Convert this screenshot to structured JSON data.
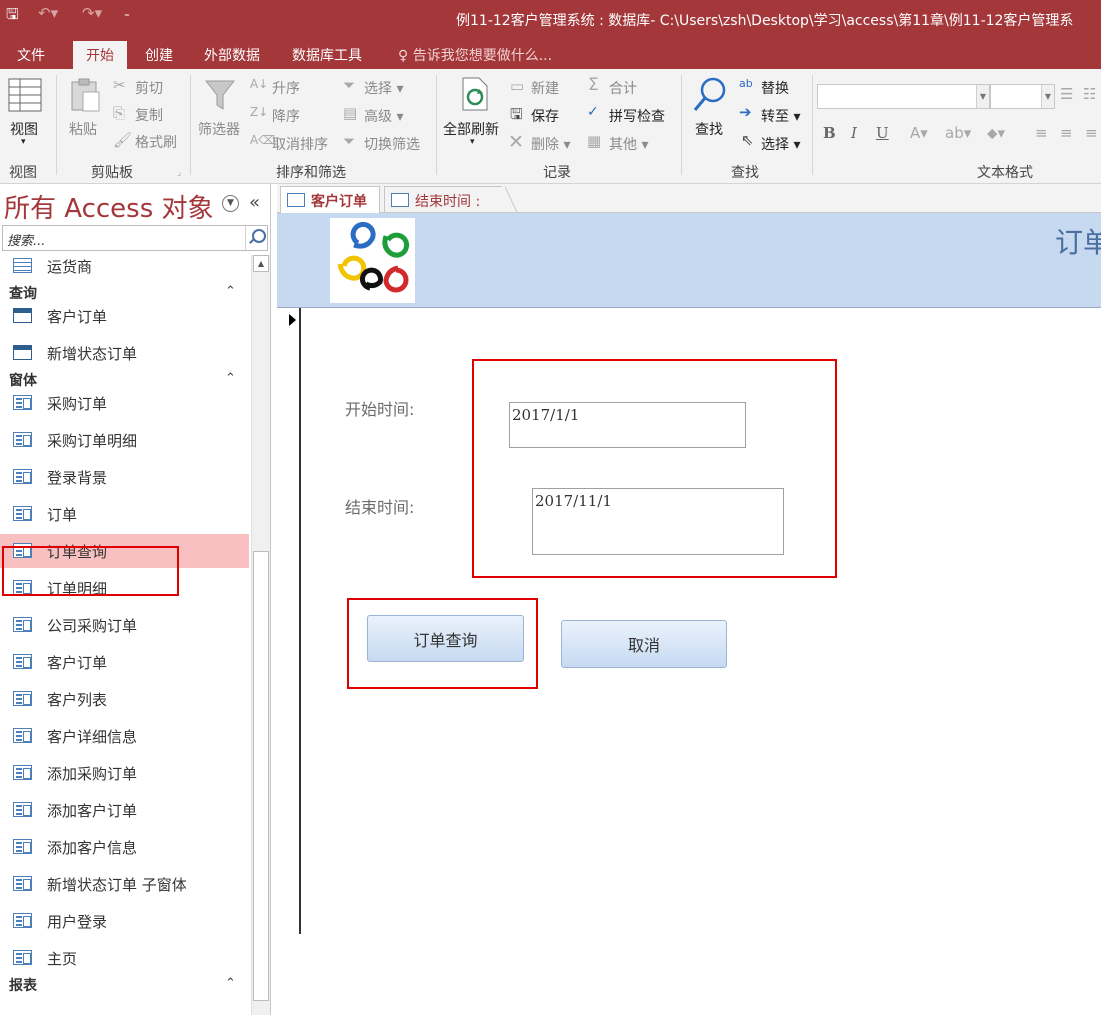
{
  "titlebar": {
    "title": "例11-12客户管理系统 : 数据库- C:\\Users\\zsh\\Desktop\\学习\\access\\第11章\\例11-12客户管理系",
    "save_icon": "save-icon",
    "undo_icon": "undo-icon",
    "redo_icon": "redo-icon",
    "qat_icon": "customize-quick-access-icon"
  },
  "ribbon_tabs": {
    "file": "文件",
    "home": "开始",
    "create": "创建",
    "external": "外部数据",
    "dbtools": "数据库工具",
    "tell": "告诉我您想要做什么..."
  },
  "ribbon": {
    "views": {
      "view": "视图",
      "group": "视图"
    },
    "clipboard": {
      "paste": "粘贴",
      "cut": "剪切",
      "copy": "复制",
      "format_painter": "格式刷",
      "group": "剪贴板"
    },
    "sort_filter": {
      "filter": "筛选器",
      "ascending": "升序",
      "descending": "降序",
      "remove_sort": "取消排序",
      "selection": "选择",
      "advanced": "高级",
      "toggle_filter": "切换筛选",
      "group": "排序和筛选"
    },
    "records": {
      "refresh_all": "全部刷新",
      "new": "新建",
      "save": "保存",
      "delete": "删除",
      "totals": "合计",
      "spelling": "拼写检查",
      "more": "其他",
      "group": "记录"
    },
    "find": {
      "find": "查找",
      "replace": "替换",
      "goto": "转至",
      "select": "选择",
      "group": "查找"
    },
    "text_format": {
      "group": "文本格式",
      "bold": "B",
      "italic": "I",
      "underline": "U"
    }
  },
  "nav": {
    "title": "所有 Access 对象",
    "search_placeholder": "搜索...",
    "tables": [
      {
        "label": "运货商"
      }
    ],
    "sections": {
      "queries": "查询",
      "forms": "窗体",
      "reports": "报表"
    },
    "queries": [
      {
        "label": "客户订单"
      },
      {
        "label": "新增状态订单"
      }
    ],
    "forms": [
      {
        "label": "采购订单"
      },
      {
        "label": "采购订单明细"
      },
      {
        "label": "登录背景"
      },
      {
        "label": "订单"
      },
      {
        "label": "订单查询",
        "selected": true
      },
      {
        "label": "订单明细"
      },
      {
        "label": "公司采购订单"
      },
      {
        "label": "客户订单"
      },
      {
        "label": "客户列表"
      },
      {
        "label": "客户详细信息"
      },
      {
        "label": "添加采购订单"
      },
      {
        "label": "添加客户订单"
      },
      {
        "label": "添加客户信息"
      },
      {
        "label": "新增状态订单 子窗体"
      },
      {
        "label": "用户登录"
      },
      {
        "label": "主页"
      }
    ]
  },
  "doc_tabs": [
    {
      "label": "客户订单"
    },
    {
      "label": "结束时间 :"
    }
  ],
  "form": {
    "header_title": "订单",
    "start_label": "开始时间:",
    "start_value": "2017/1/1",
    "end_label": "结束时间:",
    "end_value": "2017/11/1",
    "query_button": "订单查询",
    "cancel_button": "取消"
  },
  "colors": {
    "access_red": "#a4373a",
    "header_blue": "#c6d9f1",
    "highlight_pink": "#f8c0c0",
    "annotation_red": "#e00000"
  }
}
